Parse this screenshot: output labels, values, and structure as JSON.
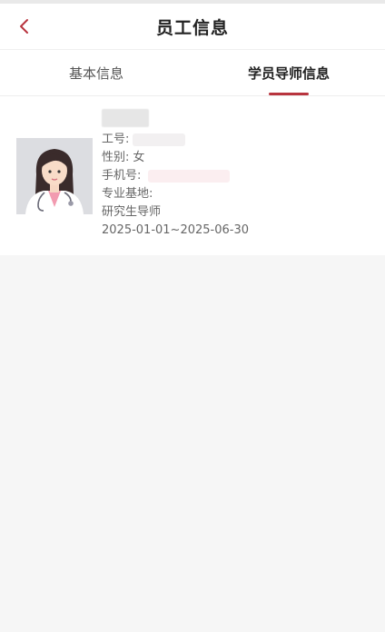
{
  "header": {
    "title": "员工信息"
  },
  "tabs": [
    {
      "label": "基本信息",
      "active": false
    },
    {
      "label": "学员导师信息",
      "active": true
    }
  ],
  "profile": {
    "employee_no_label": "工号:",
    "gender_label": "性别:",
    "gender_value": "女",
    "phone_label": "手机号:",
    "base_label": "专业基地:",
    "role": "研究生导师",
    "period": "2025-01-01~2025-06-30"
  },
  "colors": {
    "accent": "#b8343e",
    "background": "#f6f6f6"
  },
  "icons": {
    "back": "chevron-left-icon",
    "avatar": "doctor-avatar"
  }
}
